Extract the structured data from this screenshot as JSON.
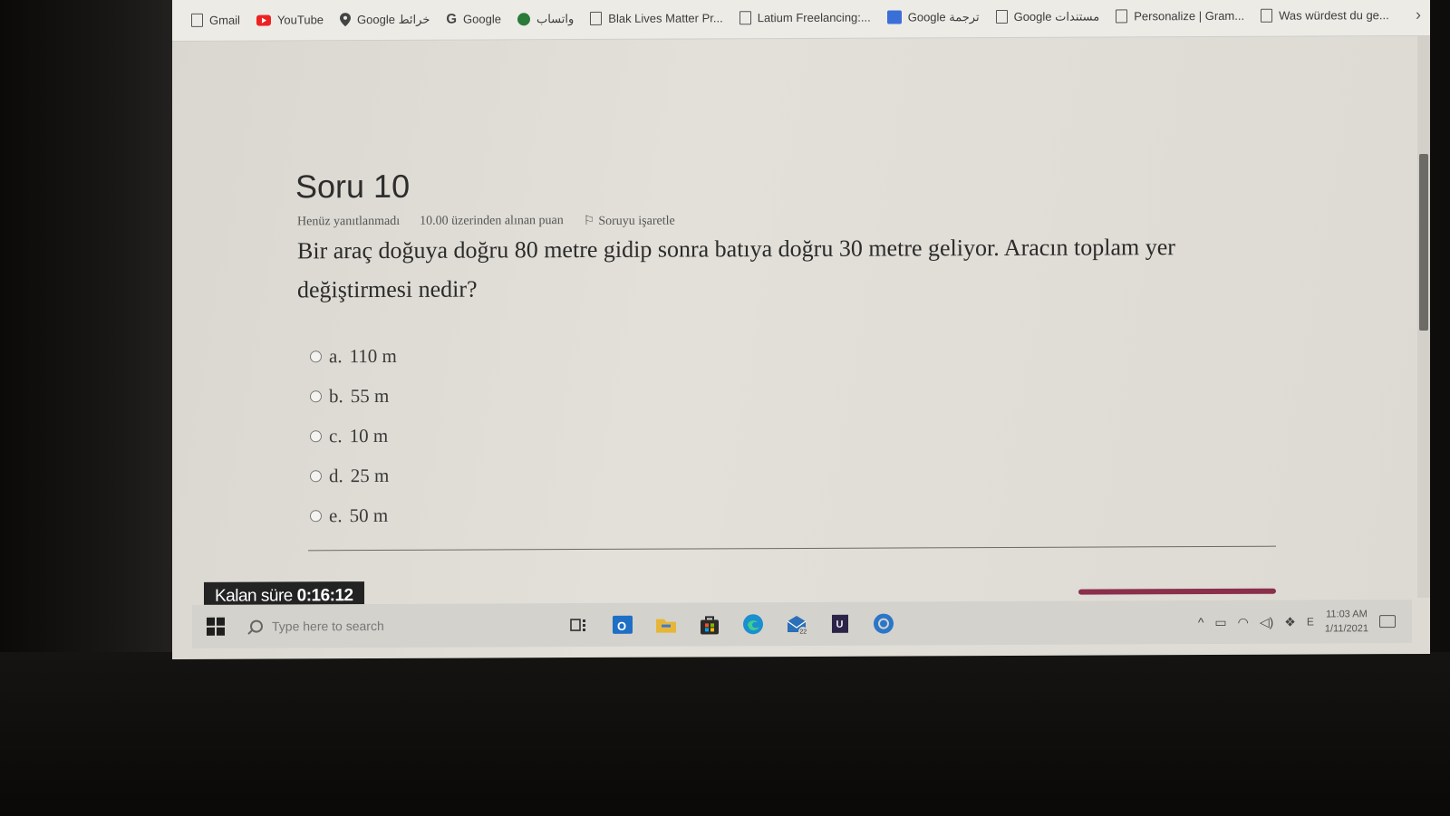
{
  "bookmarks": [
    {
      "icon": "doc-icon",
      "label": "Gmail"
    },
    {
      "icon": "youtube-icon",
      "label": "YouTube"
    },
    {
      "icon": "maps-pin-icon",
      "label": "Google خرائط"
    },
    {
      "icon": "google-icon",
      "label": "Google"
    },
    {
      "icon": "whatsapp-icon",
      "label": "واتساب"
    },
    {
      "icon": "doc-icon",
      "label": "Blak Lives Matter Pr..."
    },
    {
      "icon": "doc-icon",
      "label": "Latium Freelancing:..."
    },
    {
      "icon": "translate-icon",
      "label": "Google ترجمة"
    },
    {
      "icon": "doc-icon",
      "label": "Google مستندات"
    },
    {
      "icon": "doc-icon",
      "label": "Personalize | Gram..."
    },
    {
      "icon": "doc-icon",
      "label": "Was würdest du ge..."
    }
  ],
  "question": {
    "title": "Soru 10",
    "status": "Henüz yanıtlanmadı",
    "points": "10.00 üzerinden alınan puan",
    "flag_label": "Soruyu işaretle",
    "text": "Bir araç doğuya doğru 80 metre gidip sonra batıya doğru 30 metre geliyor. Aracın toplam yer değiştirmesi nedir?",
    "options": [
      {
        "letter": "a.",
        "value": "110 m"
      },
      {
        "letter": "b.",
        "value": "55 m"
      },
      {
        "letter": "c.",
        "value": "10 m"
      },
      {
        "letter": "d.",
        "value": "25 m"
      },
      {
        "letter": "e.",
        "value": "50 m"
      }
    ]
  },
  "timer": {
    "label": "Kalan süre",
    "value": "0:16:12"
  },
  "taskbar": {
    "search_placeholder": "Type here to search",
    "mail_badge": "22",
    "time": "11:03 AM",
    "date": "1/11/2021",
    "lang": "E"
  },
  "colors": {
    "timer_bg": "#232323",
    "progress": "#8a2f4c",
    "edge_active": "#3a7bd5"
  }
}
